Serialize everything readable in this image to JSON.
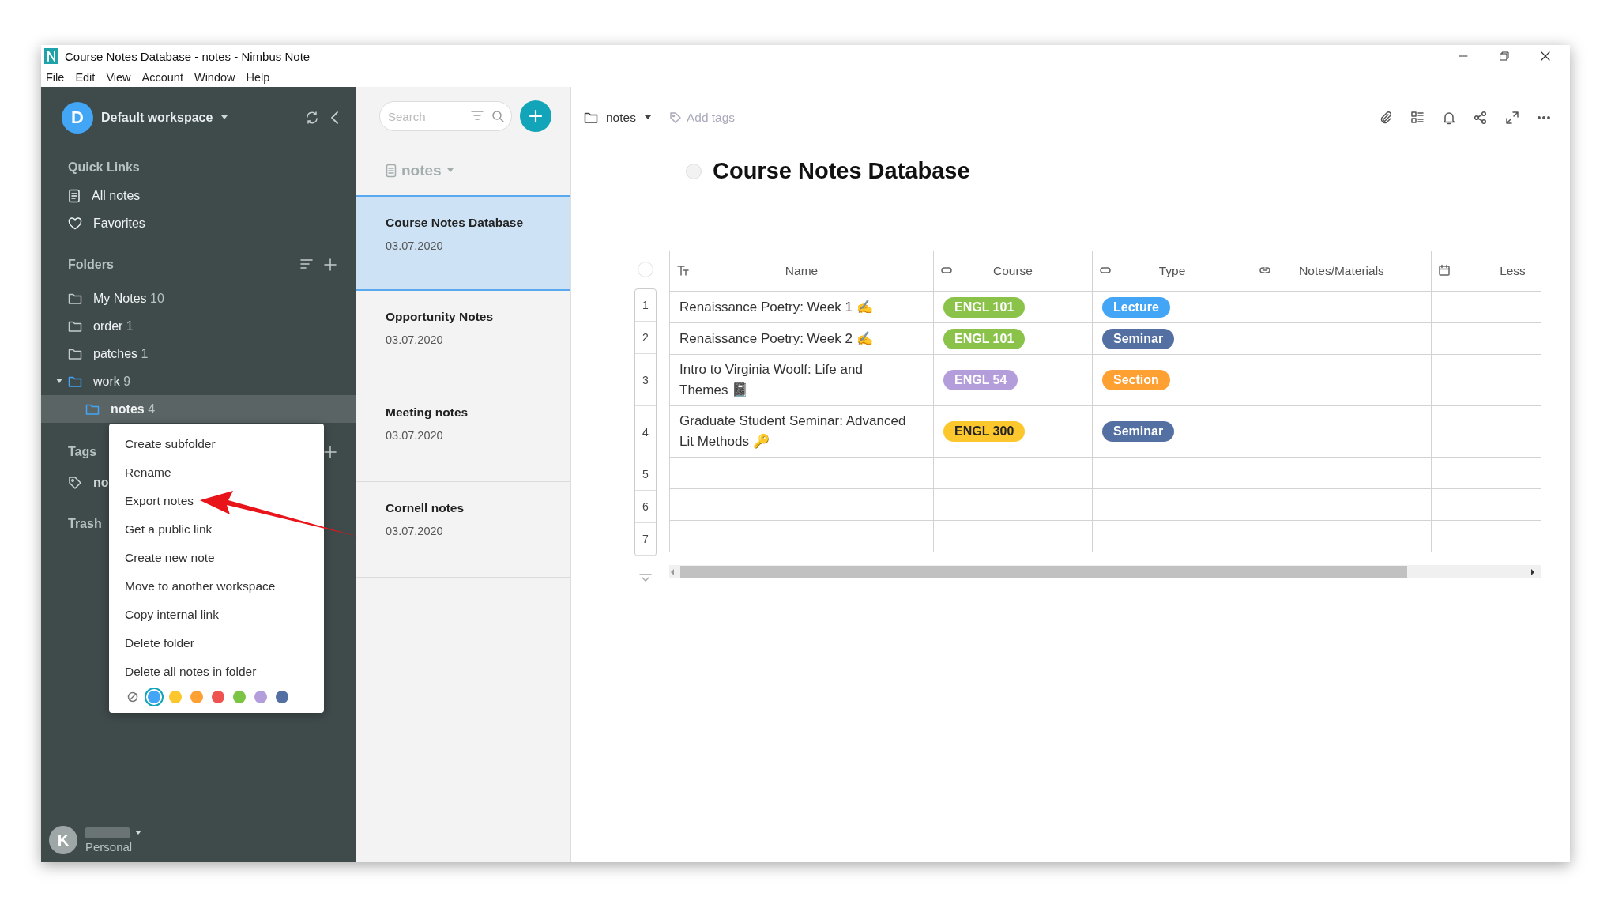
{
  "window": {
    "title": "Course Notes Database - notes - Nimbus Note"
  },
  "menu": [
    "File",
    "Edit",
    "View",
    "Account",
    "Window",
    "Help"
  ],
  "sidebar": {
    "workspace": {
      "initial": "D",
      "name": "Default workspace"
    },
    "quick_links_heading": "Quick Links",
    "quick_links": [
      {
        "label": "All notes",
        "kind": "notes"
      },
      {
        "label": "Favorites",
        "kind": "favorites"
      }
    ],
    "folders_heading": "Folders",
    "folders": [
      {
        "name": "My Notes",
        "count": "10",
        "selected": false
      },
      {
        "name": "order",
        "count": "1",
        "selected": false
      },
      {
        "name": "patches",
        "count": "1",
        "selected": false
      },
      {
        "name": "work",
        "count": "9",
        "selected": false,
        "expanded": true,
        "color": "#42a5f5",
        "children": [
          {
            "name": "notes",
            "count": "4",
            "selected": true,
            "color": "#42a5f5"
          }
        ]
      }
    ],
    "tags_heading": "Tags",
    "tags": [
      "no"
    ],
    "trash": "Trash",
    "user": {
      "initial": "K",
      "plan": "Personal"
    }
  },
  "note_list": {
    "search": {
      "placeholder": "Search"
    },
    "header": "notes",
    "notes": [
      {
        "title": "Course Notes Database",
        "date": "03.07.2020",
        "selected": true
      },
      {
        "title": "Opportunity Notes",
        "date": "03.07.2020",
        "selected": false
      },
      {
        "title": "Meeting notes",
        "date": "03.07.2020",
        "selected": false
      },
      {
        "title": "Cornell notes",
        "date": "03.07.2020",
        "selected": false
      }
    ]
  },
  "editor": {
    "folder": "notes",
    "tags_placeholder": "Add tags",
    "title": "Course Notes Database",
    "table": {
      "columns": [
        {
          "label": "Name",
          "kind": "text"
        },
        {
          "label": "Course",
          "kind": "select"
        },
        {
          "label": "Type",
          "kind": "select"
        },
        {
          "label": "Notes/Materials",
          "kind": "link"
        },
        {
          "label": "Less",
          "kind": "date"
        }
      ],
      "rows": [
        {
          "number": "1",
          "name": "Renaissance Poetry:  Week 1 ✍",
          "course": {
            "text": "ENGL 101",
            "color": "#8bc34a"
          },
          "type": {
            "text": "Lecture",
            "color": "#42a5f5"
          }
        },
        {
          "number": "2",
          "name": "Renaissance Poetry: Week 2 ✍",
          "course": {
            "text": "ENGL 101",
            "color": "#8bc34a"
          },
          "type": {
            "text": "Seminar",
            "color": "#5470a3"
          }
        },
        {
          "number": "3",
          "name": "Intro to Virginia Woolf: Life and Themes 📓",
          "course": {
            "text": "ENGL 54",
            "color": "#b39ddb"
          },
          "type": {
            "text": "Section",
            "color": "#ffa033"
          }
        },
        {
          "number": "4",
          "name": "Graduate Student Seminar: Advanced Lit Methods 🔑",
          "course": {
            "text": "ENGL 300",
            "color": "#fbc72d"
          },
          "type": {
            "text": "Seminar",
            "color": "#5470a3"
          }
        },
        {
          "number": "5"
        },
        {
          "number": "6"
        },
        {
          "number": "7"
        }
      ]
    }
  },
  "context_menu": {
    "items": [
      "Create subfolder",
      "Rename",
      "Export notes",
      "Get a public link",
      "Create new note",
      "Move to another workspace",
      "Copy internal link",
      "Delete folder",
      "Delete all notes in folder"
    ],
    "colors": [
      {
        "kind": "none",
        "selected": false
      },
      {
        "kind": "color",
        "color": "#42a5f5",
        "selected": true
      },
      {
        "kind": "color",
        "color": "#fbc72d",
        "selected": false
      },
      {
        "kind": "color",
        "color": "#ffa033",
        "selected": false
      },
      {
        "kind": "color",
        "color": "#ef5350",
        "selected": false
      },
      {
        "kind": "color",
        "color": "#7cc444",
        "selected": false
      },
      {
        "kind": "color",
        "color": "#b39ddb",
        "selected": false
      },
      {
        "kind": "color",
        "color": "#5470a3",
        "selected": false
      }
    ]
  }
}
